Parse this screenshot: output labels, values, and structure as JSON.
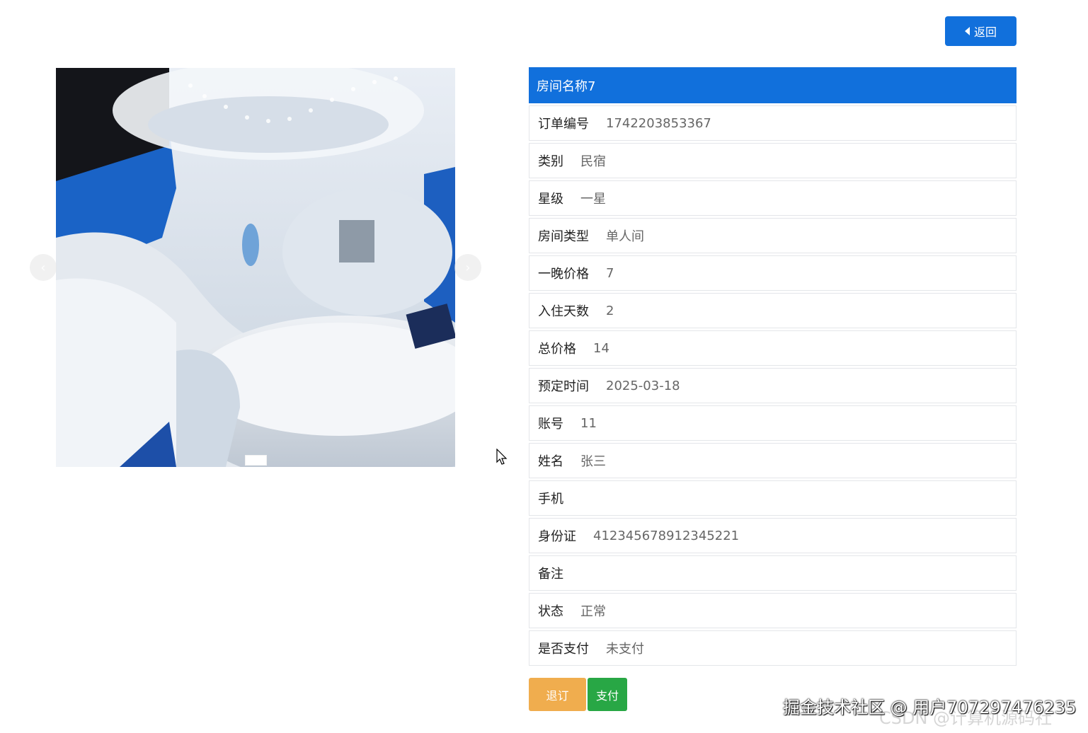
{
  "header": {
    "back_label": "返回"
  },
  "carousel": {
    "image_name": "room-photo",
    "active_index": 1,
    "total": 1
  },
  "detail": {
    "title": "房间名称7",
    "fields": [
      {
        "label": "订单编号",
        "value": "1742203853367"
      },
      {
        "label": "类别",
        "value": "民宿"
      },
      {
        "label": "星级",
        "value": "一星"
      },
      {
        "label": "房间类型",
        "value": "单人间"
      },
      {
        "label": "一晚价格",
        "value": "7"
      },
      {
        "label": "入住天数",
        "value": "2"
      },
      {
        "label": "总价格",
        "value": "14"
      },
      {
        "label": "预定时间",
        "value": "2025-03-18"
      },
      {
        "label": "账号",
        "value": "11"
      },
      {
        "label": "姓名",
        "value": "张三"
      },
      {
        "label": "手机",
        "value": ""
      },
      {
        "label": "身份证",
        "value": "412345678912345221"
      },
      {
        "label": "备注",
        "value": ""
      },
      {
        "label": "状态",
        "value": "正常"
      },
      {
        "label": "是否支付",
        "value": "未支付"
      }
    ]
  },
  "actions": {
    "cancel_label": "退订",
    "pay_label": "支付"
  },
  "watermark": {
    "line1": "掘金技术社区 @ 用户707297476235",
    "line2": "CSDN @计算机源码社"
  },
  "colors": {
    "primary": "#1170dc",
    "warning": "#f0ad4e",
    "success": "#28a745"
  }
}
